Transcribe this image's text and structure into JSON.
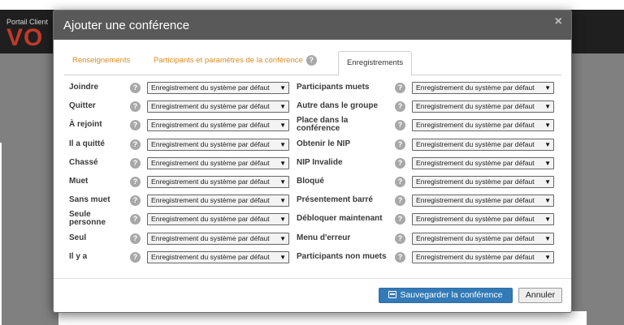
{
  "background": {
    "brand_small": "Portail Client",
    "brand_big": "VO"
  },
  "modal": {
    "title": "Ajouter une conférence",
    "close_symbol": "×",
    "help_symbol": "?",
    "tabs": [
      {
        "label": "Renseignements"
      },
      {
        "label": "Participants et paramètres de la conférence"
      },
      {
        "label": "Enregistrements",
        "active": true
      }
    ],
    "dropdown_value": "Enregistrement du système par défaut",
    "dropdown_caret": "▼",
    "left_rows": [
      {
        "label": "Joindre"
      },
      {
        "label": "Quitter"
      },
      {
        "label": "À rejoint"
      },
      {
        "label": "Il a quitté"
      },
      {
        "label": "Chassé"
      },
      {
        "label": "Muet"
      },
      {
        "label": "Sans muet"
      },
      {
        "label": "Seule personne"
      },
      {
        "label": "Seul"
      },
      {
        "label": "Il y a"
      }
    ],
    "right_rows": [
      {
        "label": "Participants muets"
      },
      {
        "label": "Autre dans le groupe"
      },
      {
        "label": "Place dans la conférence"
      },
      {
        "label": "Obtenir le NIP"
      },
      {
        "label": "NIP Invalide"
      },
      {
        "label": "Bloqué"
      },
      {
        "label": "Présentement barré"
      },
      {
        "label": "Débloquer maintenant"
      },
      {
        "label": "Menu d'erreur"
      },
      {
        "label": "Participants non muets"
      }
    ],
    "buttons": {
      "save": "Sauvegarder la conférence",
      "cancel": "Annuler"
    }
  },
  "colors": {
    "header_bg": "#595959",
    "tab_link": "#d98a1f",
    "primary_button": "#337ab7"
  }
}
